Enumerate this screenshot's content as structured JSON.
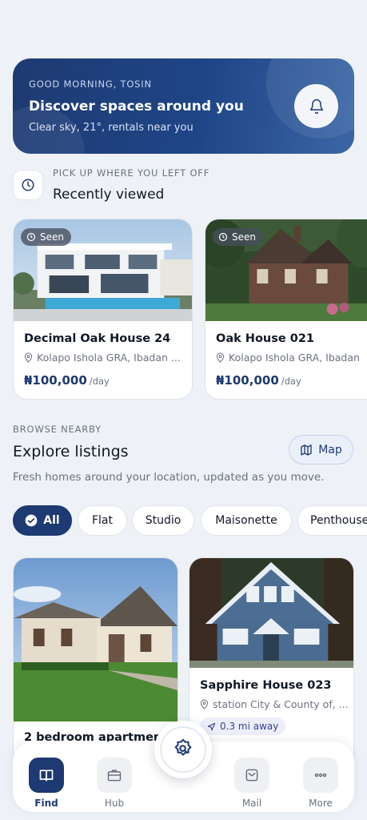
{
  "hero": {
    "greeting": "GOOD MORNING, TOSIN",
    "title": "Discover spaces around you",
    "subtitle": "Clear sky, 21°, rentals near you",
    "bell_icon": "bell-icon"
  },
  "recent": {
    "kicker": "PICK UP WHERE YOU LEFT OFF",
    "title": "Recently viewed",
    "icon": "clock-icon",
    "items": [
      {
        "badge": "Seen",
        "name": "Decimal Oak House 24",
        "location": "Kolapo Ishola GRA, Ibadan ...",
        "price": "₦100,000",
        "unit": "/day"
      },
      {
        "badge": "Seen",
        "name": "Oak House 021",
        "location": "Kolapo Ishola GRA, Ibadan",
        "price": "₦100,000",
        "unit": "/day"
      }
    ]
  },
  "explore": {
    "kicker": "BROWSE NEARBY",
    "title": "Explore listings",
    "subtitle": "Fresh homes around your location, updated as you move.",
    "map_label": "Map"
  },
  "filters": [
    "All",
    "Flat",
    "Studio",
    "Maisonette",
    "Penthouse"
  ],
  "listings": [
    {
      "name": "2 bedroom apartment O"
    },
    {
      "name": "Sapphire House 023",
      "location": "station City & County of, ...",
      "distance": "0.3 mi away"
    }
  ],
  "nav": {
    "items": [
      {
        "label": "Find",
        "icon": "book-icon",
        "active": true
      },
      {
        "label": "Hub",
        "icon": "briefcase-icon",
        "active": false
      },
      {
        "label": "Mail",
        "icon": "mail-icon",
        "active": false
      },
      {
        "label": "More",
        "icon": "more-icon",
        "active": false
      }
    ],
    "fab_icon": "search-home-icon"
  },
  "colors": {
    "primary": "#1e3a72",
    "background": "#eef1f6",
    "accent_pill": "#eceefb"
  }
}
